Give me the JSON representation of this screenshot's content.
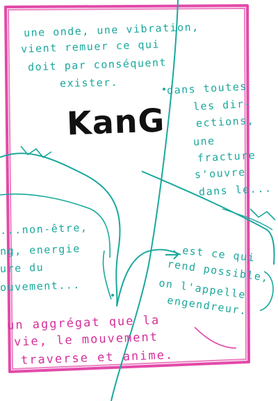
{
  "title": "KanG",
  "lines": {
    "l1": "une onde, une vibration,",
    "l2": "vient remuer ce qui",
    "l3": "doit par conséquent",
    "l4": "exister.",
    "l5": "dans toutes",
    "l6": "les dir-",
    "l7": "ections,",
    "l8": "une",
    "l9": "fracture",
    "l10": "s'ouvre",
    "l11": "dans le...",
    "l12": "...non-être,",
    "l13": "ng, energie",
    "l14": "ure du",
    "l15": "ouvement...",
    "l16": "est ce qui",
    "l17": "rend possible,",
    "l18": "on l'appelle",
    "l19": "engendreur.",
    "l20": "un aggrégat que la",
    "l21": "vie, le mouvement",
    "l22": "traverse et anime."
  },
  "colors": {
    "frame": "#e24aa8",
    "teal": "#1aa89c",
    "pink": "#d6309a",
    "ink": "#111111"
  }
}
